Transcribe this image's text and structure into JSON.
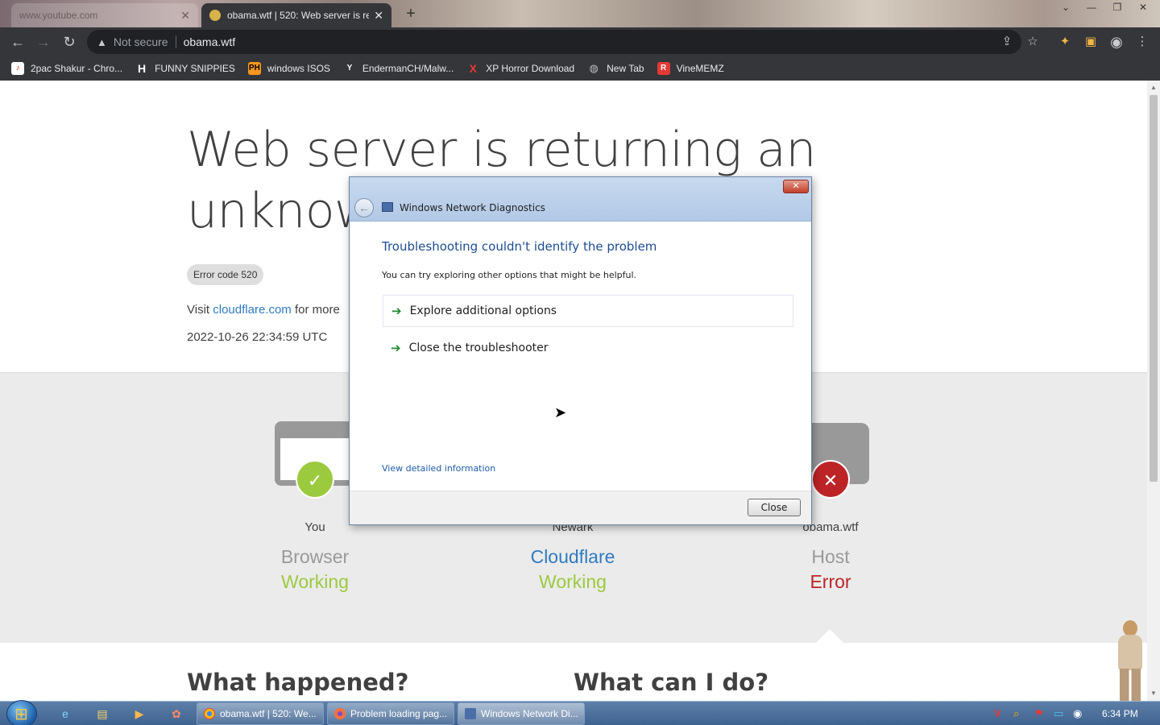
{
  "browser": {
    "tabs": [
      {
        "title": "www.youtube.com",
        "active": false
      },
      {
        "title": "obama.wtf | 520: Web server is re",
        "active": true
      }
    ],
    "address": {
      "security": "Not secure",
      "url": "obama.wtf"
    },
    "bookmarks": [
      {
        "label": "2pac Shakur - Chro...",
        "icon": "music-icon",
        "color": "#d93025"
      },
      {
        "label": "FUNNY SNIPPIES",
        "icon": "H",
        "color": "#ffffff"
      },
      {
        "label": "windows ISOS",
        "icon": "PH",
        "color": "#f7971d"
      },
      {
        "label": "EndermanCH/Malw...",
        "icon": "Y",
        "color": "#ffffff"
      },
      {
        "label": "XP Horror Download",
        "icon": "X",
        "color": "#e53935"
      },
      {
        "label": "New Tab",
        "icon": "globe-icon",
        "color": "#9e9e9e"
      },
      {
        "label": "VineMEMZ",
        "icon": "R",
        "color": "#e53935"
      }
    ]
  },
  "page": {
    "headline": "Web server is returning an unknown error",
    "error_code": "Error code 520",
    "visit_prefix": "Visit",
    "visit_link": "cloudflare.com",
    "visit_suffix": "for more",
    "timestamp": "2022-10-26 22:34:59 UTC",
    "diagnostics": [
      {
        "location": "You",
        "kind": "Browser",
        "state": "Working",
        "status": "ok"
      },
      {
        "location": "Newark",
        "kind": "Cloudflare",
        "state": "Working",
        "status": "ok"
      },
      {
        "location": "obama.wtf",
        "kind": "Host",
        "state": "Error",
        "status": "error"
      }
    ],
    "what_happened": "What happened?",
    "what_can_i_do": "What can I do?"
  },
  "dialog": {
    "title": "Windows Network Diagnostics",
    "heading": "Troubleshooting couldn't identify the problem",
    "text": "You can try exploring other options that might be helpful.",
    "options": [
      "Explore additional options",
      "Close the troubleshooter"
    ],
    "detail_link": "View detailed information",
    "close_button": "Close"
  },
  "taskbar": {
    "windows": [
      {
        "label": "obama.wtf | 520: We...",
        "icon": "chrome-icon"
      },
      {
        "label": "Problem loading pag...",
        "icon": "firefox-icon"
      },
      {
        "label": "Windows Network Di...",
        "icon": "network-diagnostics-icon"
      }
    ],
    "clock": "6:34 PM"
  },
  "colors": {
    "working": "#9bca3e",
    "error": "#bd2426",
    "link": "#2f7bbf",
    "dialog_heading": "#1e4d91"
  }
}
